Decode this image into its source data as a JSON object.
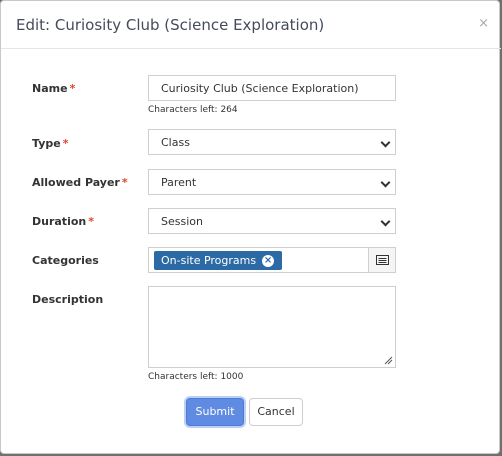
{
  "modal": {
    "title": "Edit: Curiosity Club (Science Exploration)",
    "close_icon": "×"
  },
  "form": {
    "required_marker": "*",
    "name": {
      "label": "Name",
      "value": "Curiosity Club (Science Exploration)",
      "helper": "Characters left: 264"
    },
    "type": {
      "label": "Type",
      "value": "Class"
    },
    "allowed_payer": {
      "label": "Allowed Payer",
      "value": "Parent"
    },
    "duration": {
      "label": "Duration",
      "value": "Session"
    },
    "categories": {
      "label": "Categories",
      "tags": [
        "On-site Programs"
      ],
      "picker_icon": "list-picker-icon"
    },
    "description": {
      "label": "Description",
      "value": "",
      "helper": "Characters left: 1000"
    }
  },
  "buttons": {
    "submit": "Submit",
    "cancel": "Cancel"
  },
  "colors": {
    "primary": "#5f8ce2",
    "tag": "#2c6aa6",
    "required": "#e0452f"
  }
}
